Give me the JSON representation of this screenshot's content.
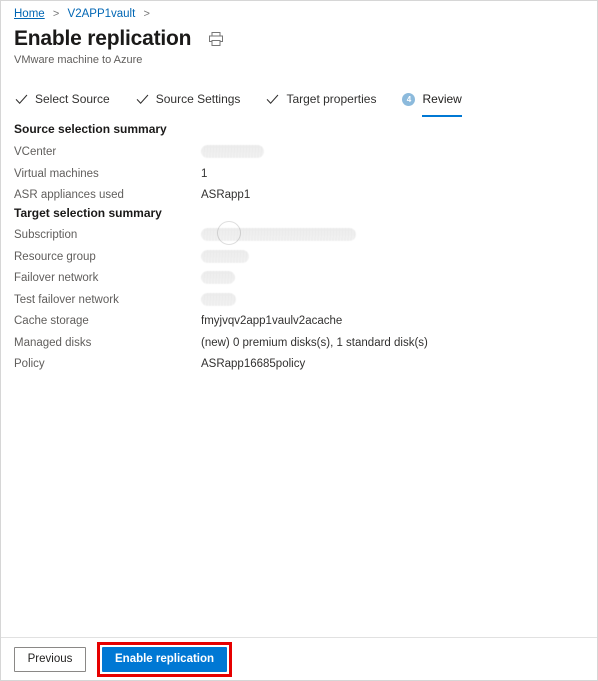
{
  "breadcrumb": {
    "items": [
      {
        "label": "Home",
        "active": true
      },
      {
        "label": "V2APP1vault",
        "active": false
      }
    ],
    "separator": ">"
  },
  "header": {
    "title": "Enable replication",
    "subtitle": "VMware machine to Azure",
    "print_icon": "print-icon"
  },
  "tabs": [
    {
      "label": "Select Source",
      "state": "completed",
      "icon": "check-icon"
    },
    {
      "label": "Source Settings",
      "state": "completed",
      "icon": "check-icon"
    },
    {
      "label": "Target properties",
      "state": "completed",
      "icon": "check-icon"
    },
    {
      "label": "Review",
      "state": "current",
      "badge": "4"
    }
  ],
  "source_summary": {
    "heading": "Source selection summary",
    "rows": [
      {
        "label": "VCenter",
        "value": "",
        "redacted": true,
        "redact_width": 63
      },
      {
        "label": "Virtual machines",
        "value": "1",
        "redacted": false
      },
      {
        "label": "ASR appliances used",
        "value": "ASRapp1",
        "redacted": false
      }
    ]
  },
  "target_summary": {
    "heading": "Target selection summary",
    "rows": [
      {
        "label": "Subscription",
        "value": "",
        "redacted": true,
        "redact_width": 155
      },
      {
        "label": "Resource group",
        "value": "",
        "redacted": true,
        "redact_width": 48
      },
      {
        "label": "Failover network",
        "value": "",
        "redacted": true,
        "redact_width": 34
      },
      {
        "label": "Test failover network",
        "value": "",
        "redacted": true,
        "redact_width": 35
      },
      {
        "label": "Cache storage",
        "value": "fmyjvqv2app1vaulv2acache",
        "redacted": false
      },
      {
        "label": "Managed disks",
        "value": "(new) 0 premium disks(s), 1 standard disk(s)",
        "redacted": false
      },
      {
        "label": "Policy",
        "value": "ASRapp16685policy",
        "redacted": false
      }
    ]
  },
  "footer": {
    "previous_label": "Previous",
    "submit_label": "Enable replication"
  },
  "colors": {
    "accent": "#0078d4",
    "link": "#0066b4",
    "badge": "#8cbadc",
    "highlight": "#e60000",
    "label_text": "#605e5c",
    "value_text": "#323130"
  }
}
